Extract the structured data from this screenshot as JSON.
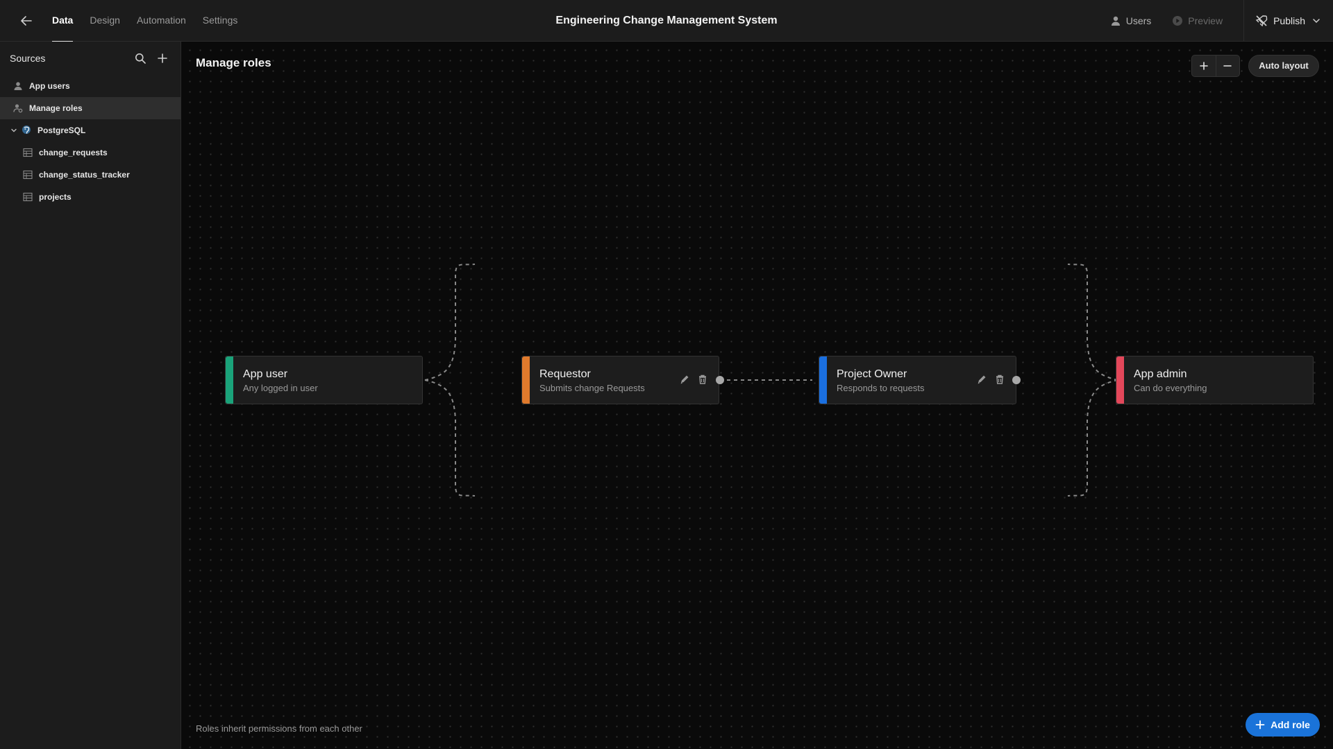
{
  "topbar": {
    "back_icon": "arrow-left-icon",
    "tabs": [
      {
        "label": "Data",
        "active": true
      },
      {
        "label": "Design",
        "active": false
      },
      {
        "label": "Automation",
        "active": false
      },
      {
        "label": "Settings",
        "active": false
      }
    ],
    "app_title": "Engineering Change Management System",
    "users_label": "Users",
    "preview_label": "Preview",
    "publish_label": "Publish"
  },
  "sidebar": {
    "title": "Sources",
    "items": [
      {
        "label": "App users",
        "icon": "user-icon"
      },
      {
        "label": "Manage roles",
        "icon": "roles-icon",
        "active": true
      },
      {
        "label": "PostgreSQL",
        "icon": "postgresql-icon",
        "expanded": true
      },
      {
        "label": "change_requests",
        "icon": "table-icon"
      },
      {
        "label": "change_status_tracker",
        "icon": "table-icon"
      },
      {
        "label": "projects",
        "icon": "table-icon"
      }
    ]
  },
  "canvas": {
    "title": "Manage roles",
    "auto_layout_label": "Auto layout",
    "footnote": "Roles inherit permissions from each other",
    "add_role_label": "Add role",
    "roles": [
      {
        "name": "App user",
        "description": "Any logged in user",
        "color": "#1aa37a"
      },
      {
        "name": "Requestor",
        "description": "Submits change Requests",
        "color": "#e07a2c"
      },
      {
        "name": "Project Owner",
        "description": "Responds to requests",
        "color": "#1a6fe0"
      },
      {
        "name": "App admin",
        "description": "Can do everything",
        "color": "#e3475a"
      }
    ]
  },
  "colors": {
    "accent": "#1a73d9",
    "background": "#0a0a0a",
    "panel": "#1c1c1c"
  }
}
